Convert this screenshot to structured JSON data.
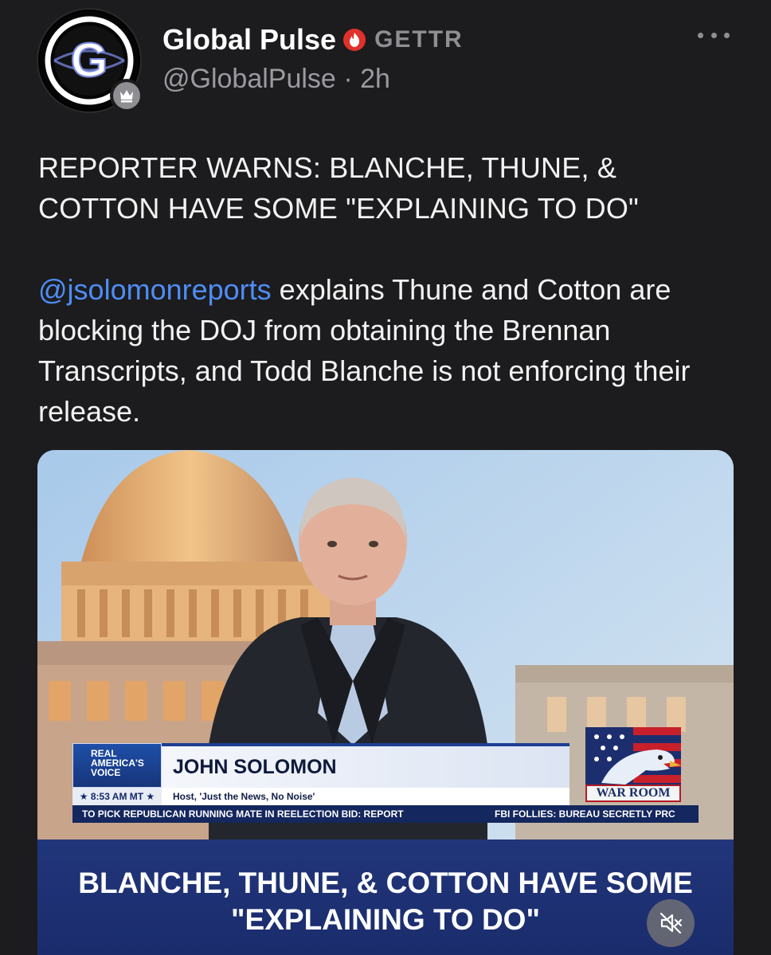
{
  "post": {
    "author": {
      "display_name": "Global Pulse",
      "platform_tag": "GETTR",
      "handle": "@GlobalPulse",
      "separator": "·",
      "time": "2h",
      "avatar_icon": "global-pulse-g-logo",
      "badge_icon": "crown-badge-icon",
      "verified_icon": "verified-flame-badge-icon",
      "verified_color": "#e0312c"
    },
    "more_icon": "more-horizontal-icon",
    "headline_line1": "REPORTER WARNS: BLANCHE, THUNE, &",
    "headline_line2": "COTTON HAVE SOME \"EXPLAINING TO DO\"",
    "body": {
      "mention": "@jsolomonreports",
      "text_after_mention": " explains Thune and Cotton are blocking the DOJ from obtaining the Brennan Transcripts, and Todd Blanche is not enforcing their release.",
      "mention_color": "#4f8df7"
    },
    "media": {
      "network_logo_line1": "REAL",
      "network_logo_line2": "AMERICA'S",
      "network_logo_line3": "VOICE",
      "time_chip": "★ 8:53 AM MT ★",
      "guest_name": "JOHN SOLOMON",
      "guest_title": "Host, 'Just the News, No Noise'",
      "ticker_left": "TO PICK REPUBLICAN RUNNING MATE IN REELECTION BID: REPORT",
      "ticker_right": "FBI FOLLIES: BUREAU SECRETLY PRC",
      "show_logo": "WAR ROOM",
      "caption_line1": "BLANCHE, THUNE, & COTTON HAVE SOME",
      "caption_line2": "\"EXPLAINING TO DO\"",
      "mute_icon": "volume-muted-icon"
    }
  }
}
